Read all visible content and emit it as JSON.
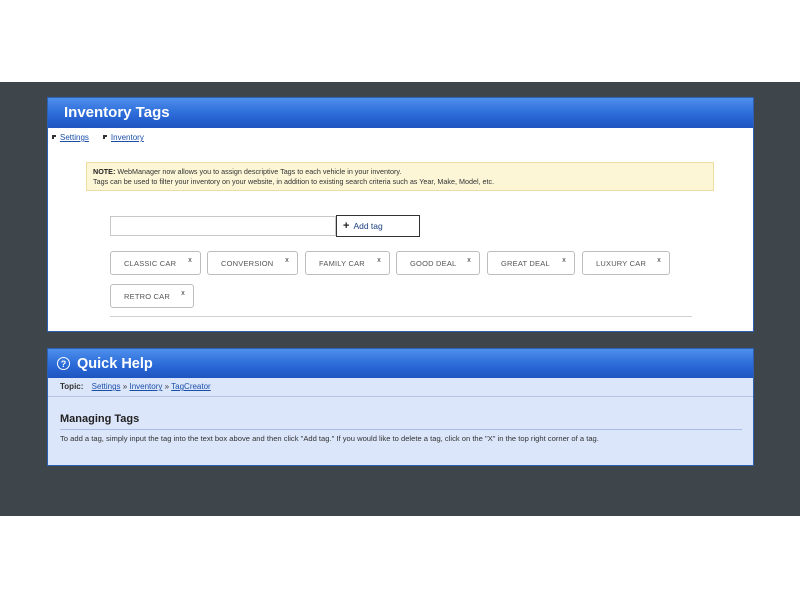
{
  "inventory_panel": {
    "title": "Inventory Tags",
    "breadcrumbs": [
      "Settings",
      "Inventory"
    ],
    "note_label": "NOTE:",
    "note_line1": "WebManager now allows you to assign descriptive Tags to each vehicle in your inventory.",
    "note_line2": "Tags can be used to filter your inventory on your website, in addition to existing search criteria such as Year, Make, Model, etc.",
    "input_value": "",
    "add_button_label": "Add tag",
    "tags": [
      "CLASSIC CAR",
      "CONVERSION",
      "FAMILY CAR",
      "GOOD DEAL",
      "GREAT DEAL",
      "LUXURY CAR",
      "RETRO CAR"
    ],
    "tag_remove_glyph": "x"
  },
  "help_panel": {
    "title": "Quick Help",
    "icon": "question-circle-icon",
    "topic_label": "Topic:",
    "topic_links": [
      "Settings",
      "Inventory",
      "TagCreator"
    ],
    "topic_separator": "»",
    "section_title": "Managing Tags",
    "body": "To add a tag, simply input the tag into the text box above and then click \"Add tag.\" If you would like to delete a tag, click on the \"X\" in the top right corner of a tag."
  },
  "colors": {
    "header_blue": "#2b6ad8",
    "app_background": "#3e454b",
    "note_background": "#fcf6d6",
    "help_background": "#dce6fa"
  }
}
